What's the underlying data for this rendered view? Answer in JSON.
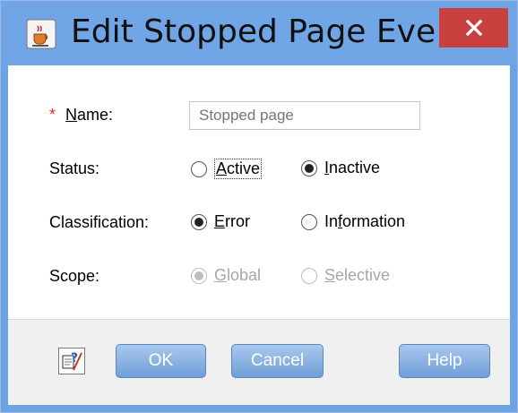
{
  "window": {
    "title": "Edit Stopped Page Eve...",
    "close_glyph": "✕",
    "app_icon": "java-cup-icon"
  },
  "form": {
    "name": {
      "required_mark": "*",
      "label_mnemonic": "N",
      "label_rest": "ame:",
      "placeholder": "Stopped page"
    },
    "status": {
      "label": "Status:",
      "options": [
        {
          "mnemonic": "A",
          "rest": "ctive",
          "checked": false
        },
        {
          "mnemonic": "I",
          "rest": "nactive",
          "checked": true
        }
      ]
    },
    "classification": {
      "label": "Classification:",
      "options": [
        {
          "mnemonic": "E",
          "rest": "rror",
          "checked": true
        },
        {
          "pre": "In",
          "mnemonic": "f",
          "rest": "ormation",
          "checked": false
        }
      ]
    },
    "scope": {
      "label": "Scope:",
      "options": [
        {
          "mnemonic": "G",
          "rest": "lobal",
          "checked": true,
          "disabled": true
        },
        {
          "mnemonic": "S",
          "rest": "elective",
          "checked": false,
          "disabled": true
        }
      ]
    }
  },
  "footer": {
    "help_icon": "context-help-icon",
    "ok_label": "OK",
    "cancel_label": "Cancel",
    "help_label": "Help"
  },
  "colors": {
    "titlebar": "#71a6e6",
    "close": "#c9413f",
    "required": "#d0302f",
    "button": "#7fa9dd"
  }
}
